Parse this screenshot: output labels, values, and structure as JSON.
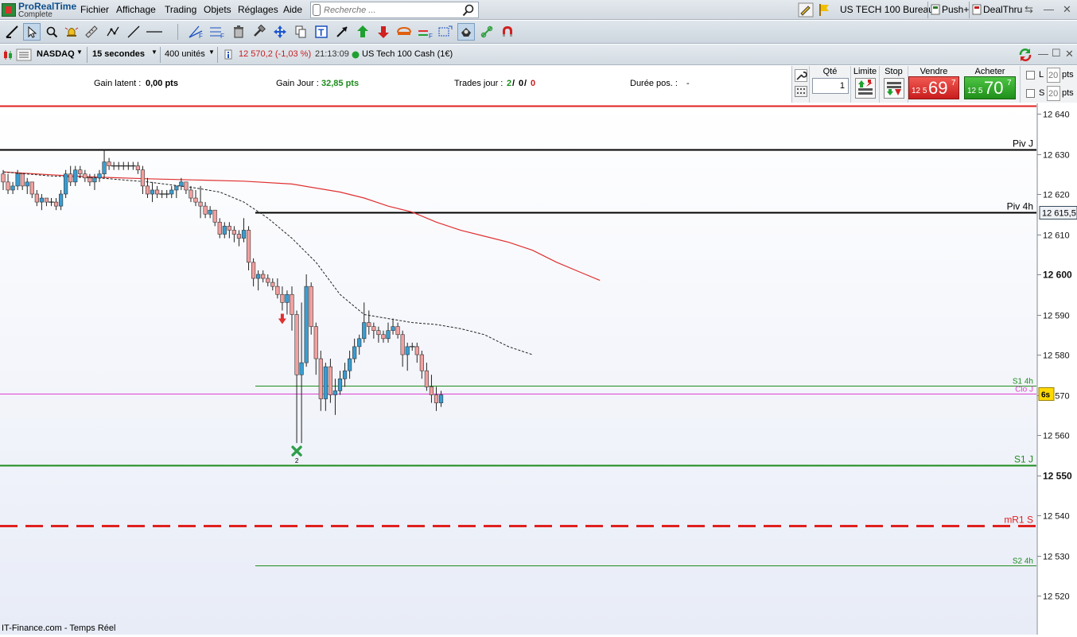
{
  "app": {
    "brand_line1": "ProRealTime",
    "brand_line2": "Complete"
  },
  "menu": [
    "Fichier",
    "Affichage",
    "Trading",
    "Objets",
    "Réglages",
    "Aide"
  ],
  "search": {
    "placeholder": "Recherche ..."
  },
  "topright": {
    "workspace": "US TECH 100 Bureau",
    "push": "Push+",
    "dealthru": "DealThru"
  },
  "instrument": {
    "market": "NASDAQ",
    "timeframe": "15 secondes",
    "units": "400 unités",
    "quote": "12 570,2 (-1,03 %)",
    "time": "21:13:09",
    "name": "US Tech 100 Cash (1€)"
  },
  "stats": {
    "gain_latent_label": "Gain latent :",
    "gain_latent_value": "0,00 pts",
    "gain_jour_label": "Gain Jour :",
    "gain_jour_value": "32,85 pts",
    "trades_jour_label": "Trades jour :",
    "trades_a": "2",
    "trades_b": "0",
    "trades_c": "0",
    "duree_label": "Durée pos. :",
    "duree_value": "-"
  },
  "order": {
    "qty_label": "Qté",
    "qty_value": "1",
    "limit_label": "Limite",
    "stop_label": "Stop",
    "sell_label": "Vendre",
    "buy_label": "Acheter",
    "sell_prefix": "12 5",
    "sell_big": "69",
    "sell_sup": "7",
    "buy_prefix": "12 5",
    "buy_big": "70",
    "buy_sup": "7",
    "l_label": "L",
    "s_label": "S",
    "l_value": "20",
    "s_value": "20",
    "pts": "pts"
  },
  "colors": {
    "bull": "#3a9dd1",
    "bear": "#f2a0a0",
    "ma_red": "#e03030",
    "green": "#1e8c1e",
    "magenta": "#e040d0"
  },
  "chart_data": {
    "type": "candlestick",
    "title": "",
    "ylim": [
      12515,
      12642
    ],
    "y_ticks": [
      12520,
      12530,
      12540,
      12550,
      12560,
      12570,
      12580,
      12590,
      12600,
      12610,
      12620,
      12630,
      12640
    ],
    "y_tick_labels": [
      "12 520",
      "12 530",
      "12 540",
      "12 550",
      "12 560",
      "12 570",
      "12 580",
      "12 590",
      "12 600",
      "12 610",
      "12 620",
      "12 630",
      "12 640"
    ],
    "bold_ticks": [
      12550,
      12600
    ],
    "current_price": 12570.2,
    "current_tag": "6s",
    "levels": [
      {
        "name": "Piv J",
        "value": 12631,
        "color": "#000000",
        "width": 2,
        "dash": "",
        "from": "full"
      },
      {
        "name": "Piv 4h",
        "value": 12615.5,
        "color": "#000000",
        "width": 2,
        "dash": "",
        "from": "partial",
        "tag": "12 615,5"
      },
      {
        "name": "S1 4h",
        "value": 12572.2,
        "color": "#1e8c1e",
        "width": 1,
        "dash": "",
        "from": "partial"
      },
      {
        "name": "Clo J",
        "value": 12570.2,
        "color": "#e040d0",
        "width": 1,
        "dash": "",
        "from": "full"
      },
      {
        "name": "S1 J",
        "value": 12552.5,
        "color": "#1e8c1e",
        "width": 2,
        "dash": "",
        "from": "full"
      },
      {
        "name": "mR1 S",
        "value": 12537.5,
        "color": "#e02020",
        "width": 3,
        "dash": "22 10",
        "from": "full"
      },
      {
        "name": "S2 4h",
        "value": 12527.5,
        "color": "#1e8c1e",
        "width": 1,
        "dash": "",
        "from": "partial"
      },
      {
        "name": "",
        "value": 12642,
        "color": "#e02020",
        "width": 2,
        "dash": "",
        "from": "full"
      }
    ],
    "candles": [
      [
        12625,
        12626,
        12621,
        12623
      ],
      [
        12623,
        12625,
        12620,
        12621
      ],
      [
        12621,
        12623,
        12620,
        12622
      ],
      [
        12622,
        12626,
        12621,
        12625
      ],
      [
        12625,
        12625,
        12621,
        12622
      ],
      [
        12622,
        12624,
        12620,
        12623
      ],
      [
        12623,
        12623,
        12619,
        12620
      ],
      [
        12620,
        12621,
        12617,
        12618
      ],
      [
        12618,
        12620,
        12616,
        12619
      ],
      [
        12619,
        12619,
        12617,
        12618
      ],
      [
        12618,
        12619,
        12617,
        12618
      ],
      [
        12618,
        12619,
        12616,
        12617
      ],
      [
        12617,
        12621,
        12616,
        12620
      ],
      [
        12620,
        12626,
        12619,
        12625
      ],
      [
        12625,
        12627,
        12622,
        12623
      ],
      [
        12623,
        12627,
        12622,
        12626
      ],
      [
        12626,
        12627,
        12624,
        12625
      ],
      [
        12625,
        12626,
        12623,
        12624
      ],
      [
        12624,
        12625,
        12622,
        12623
      ],
      [
        12623,
        12625,
        12621,
        12624
      ],
      [
        12624,
        12626,
        12623,
        12625
      ],
      [
        12625,
        12631,
        12624,
        12628
      ],
      [
        12628,
        12629,
        12626,
        12627
      ],
      [
        12627,
        12628,
        12626,
        12627
      ],
      [
        12627,
        12628,
        12626,
        12627
      ],
      [
        12627,
        12628,
        12626,
        12627
      ],
      [
        12627,
        12628,
        12626,
        12627
      ],
      [
        12627,
        12628,
        12626,
        12627
      ],
      [
        12627,
        12628,
        12625,
        12626
      ],
      [
        12626,
        12627,
        12620,
        12622
      ],
      [
        12622,
        12624,
        12619,
        12620
      ],
      [
        12620,
        12623,
        12618,
        12621
      ],
      [
        12621,
        12622,
        12619,
        12620
      ],
      [
        12620,
        12621,
        12619,
        12620
      ],
      [
        12620,
        12621,
        12619,
        12620
      ],
      [
        12620,
        12622,
        12619,
        12621
      ],
      [
        12621,
        12622,
        12619,
        12622
      ],
      [
        12622,
        12624,
        12621,
        12623
      ],
      [
        12623,
        12623,
        12620,
        12621
      ],
      [
        12621,
        12622,
        12618,
        12619
      ],
      [
        12619,
        12621,
        12617,
        12618
      ],
      [
        12618,
        12622,
        12614,
        12617
      ],
      [
        12617,
        12618,
        12614,
        12615
      ],
      [
        12615,
        12617,
        12614,
        12616
      ],
      [
        12616,
        12616,
        12612,
        12613
      ],
      [
        12613,
        12614,
        12609,
        12610
      ],
      [
        12610,
        12613,
        12609,
        12612
      ],
      [
        12612,
        12613,
        12609,
        12611
      ],
      [
        12611,
        12612,
        12608,
        12610
      ],
      [
        12610,
        12611,
        12607,
        12609
      ],
      [
        12609,
        12614,
        12608,
        12611
      ],
      [
        12611,
        12612,
        12601,
        12603
      ],
      [
        12603,
        12604,
        12597,
        12599
      ],
      [
        12599,
        12601,
        12596,
        12600
      ],
      [
        12600,
        12601,
        12598,
        12599
      ],
      [
        12599,
        12600,
        12597,
        12598
      ],
      [
        12598,
        12599,
        12596,
        12597
      ],
      [
        12597,
        12599,
        12594,
        12595
      ],
      [
        12595,
        12597,
        12591,
        12593
      ],
      [
        12593,
        12596,
        12590,
        12595
      ],
      [
        12595,
        12597,
        12586,
        12590
      ],
      [
        12590,
        12591,
        12558,
        12575
      ],
      [
        12575,
        12593,
        12558,
        12578
      ],
      [
        12578,
        12600,
        12577,
        12597
      ],
      [
        12597,
        12598,
        12585,
        12587
      ],
      [
        12587,
        12588,
        12575,
        12579
      ],
      [
        12579,
        12581,
        12566,
        12569
      ],
      [
        12569,
        12578,
        12566,
        12577
      ],
      [
        12577,
        12579,
        12568,
        12570
      ],
      [
        12570,
        12574,
        12565,
        12571
      ],
      [
        12571,
        12576,
        12570,
        12574
      ],
      [
        12574,
        12578,
        12572,
        12576
      ],
      [
        12576,
        12581,
        12574,
        12579
      ],
      [
        12579,
        12584,
        12578,
        12582
      ],
      [
        12582,
        12585,
        12580,
        12584
      ],
      [
        12584,
        12593,
        12583,
        12588
      ],
      [
        12588,
        12591,
        12585,
        12587
      ],
      [
        12587,
        12588,
        12584,
        12586
      ],
      [
        12586,
        12587,
        12583,
        12585
      ],
      [
        12585,
        12586,
        12583,
        12584
      ],
      [
        12584,
        12588,
        12583,
        12586
      ],
      [
        12586,
        12589,
        12585,
        12587
      ],
      [
        12587,
        12588,
        12584,
        12585
      ],
      [
        12585,
        12586,
        12577,
        12580
      ],
      [
        12580,
        12583,
        12576,
        12582
      ],
      [
        12582,
        12583,
        12581,
        12582
      ],
      [
        12582,
        12583,
        12578,
        12580
      ],
      [
        12580,
        12581,
        12574,
        12576
      ],
      [
        12576,
        12578,
        12571,
        12572
      ],
      [
        12572,
        12575,
        12568,
        12570
      ],
      [
        12570,
        12572,
        12566,
        12568
      ],
      [
        12568,
        12571,
        12567,
        12570
      ]
    ],
    "ma_red": [
      [
        0,
        12625.5
      ],
      [
        10,
        12624.8
      ],
      [
        20,
        12624.2
      ],
      [
        30,
        12623.8
      ],
      [
        40,
        12623.5
      ],
      [
        50,
        12623.2
      ],
      [
        60,
        12622.5
      ],
      [
        70,
        12620.5
      ],
      [
        75,
        12619
      ],
      [
        80,
        12617
      ],
      [
        85,
        12615.5
      ],
      [
        90,
        12613
      ],
      [
        95,
        12611
      ],
      [
        100,
        12609.5
      ],
      [
        105,
        12608
      ],
      [
        110,
        12606
      ],
      [
        115,
        12603
      ],
      [
        120,
        12600.5
      ],
      [
        124,
        12598.5
      ]
    ],
    "ma_dash": [
      [
        0,
        12625.5
      ],
      [
        10,
        12624.5
      ],
      [
        20,
        12624
      ],
      [
        30,
        12623
      ],
      [
        40,
        12621.5
      ],
      [
        45,
        12620.5
      ],
      [
        50,
        12618
      ],
      [
        55,
        12614
      ],
      [
        60,
        12609
      ],
      [
        65,
        12603
      ],
      [
        70,
        12595
      ],
      [
        75,
        12590
      ],
      [
        80,
        12589
      ],
      [
        85,
        12588
      ],
      [
        90,
        12587.5
      ],
      [
        95,
        12586.5
      ],
      [
        100,
        12585
      ],
      [
        105,
        12582
      ],
      [
        110,
        12580
      ]
    ],
    "markers": [
      {
        "type": "sell-arrow",
        "index": 58,
        "price": 12589,
        "color": "#e03030"
      },
      {
        "type": "close-cross",
        "index": 61,
        "price": 12556,
        "label": "2",
        "color": "#2e9e4a"
      }
    ]
  },
  "footer": "IT-Finance.com - Temps Réel"
}
